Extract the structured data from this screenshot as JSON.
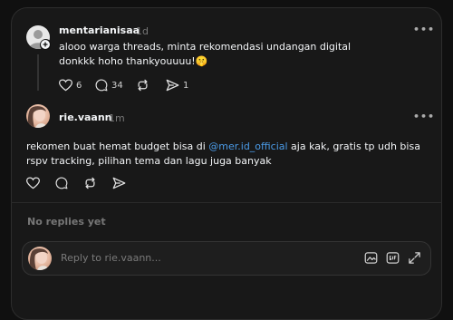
{
  "posts": [
    {
      "handle": "mentarianisaa",
      "time": "1d",
      "text": "alooo warga threads, minta rekomendasi undangan digital donkkk hoho thankyouuuu!🤫",
      "likes": "6",
      "replies": "34",
      "shares": "1"
    },
    {
      "handle": "rie.vaann",
      "time": "1m",
      "text_before": "rekomen buat hemat budget bisa di ",
      "mention": "@mer.id_official",
      "text_after": " aja kak, gratis tp udh bisa rspv tracking, pilihan tema dan lagu juga banyak"
    }
  ],
  "more_label": "•••",
  "no_replies": "No replies yet",
  "reply": {
    "placeholder": "Reply to rie.vaann..."
  },
  "icons": [
    "heart-icon",
    "comment-icon",
    "repost-icon",
    "share-icon",
    "follow-plus-icon",
    "image-icon",
    "gif-icon",
    "expand-icon"
  ],
  "colors": {
    "background": "#101010",
    "card": "#181818",
    "mention": "#4b9be8",
    "muted": "#777777"
  }
}
